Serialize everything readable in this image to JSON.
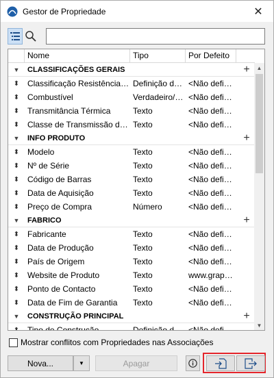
{
  "window": {
    "title": "Gestor de Propriedade"
  },
  "icons": {
    "app": "archicad-logo-icon",
    "close": "close-icon",
    "list_view": "list-view-icon",
    "search": "search-icon",
    "drag_handle": "drag-handle-icon",
    "collapse": "collapse-triangle-icon",
    "add": "plus-icon",
    "info": "info-icon",
    "import": "import-icon",
    "export": "export-icon"
  },
  "search": {
    "value": ""
  },
  "table": {
    "headers": {
      "name": "Nome",
      "type": "Tipo",
      "default": "Por Defeito"
    },
    "groups": [
      {
        "name": "CLASSIFICAÇÕES GERAIS",
        "rows": [
          {
            "name": "Classificação Resistência ao Fogo",
            "type": "Definição de Opções",
            "default": "<Não definido>"
          },
          {
            "name": "Combustível",
            "type": "Verdadeiro/Falso",
            "default": "<Não definido>"
          },
          {
            "name": "Transmitância Térmica",
            "type": "Texto",
            "default": "<Não definido>"
          },
          {
            "name": "Classe de Transmissão de Som",
            "type": "Texto",
            "default": "<Não definido>"
          }
        ]
      },
      {
        "name": "INFO PRODUTO",
        "rows": [
          {
            "name": "Modelo",
            "type": "Texto",
            "default": "<Não definido>"
          },
          {
            "name": "Nº de Série",
            "type": "Texto",
            "default": "<Não definido>"
          },
          {
            "name": "Código de Barras",
            "type": "Texto",
            "default": "<Não definido>"
          },
          {
            "name": "Data de Aquisição",
            "type": "Texto",
            "default": "<Não definido>"
          },
          {
            "name": "Preço de Compra",
            "type": "Número",
            "default": "<Não definido>"
          }
        ]
      },
      {
        "name": "FABRICO",
        "rows": [
          {
            "name": "Fabricante",
            "type": "Texto",
            "default": "<Não definido>"
          },
          {
            "name": "Data de Produção",
            "type": "Texto",
            "default": "<Não definido>"
          },
          {
            "name": "País de Origem",
            "type": "Texto",
            "default": "<Não definido>"
          },
          {
            "name": "Website de Produto",
            "type": "Texto",
            "default": "www.graphisoft.com"
          },
          {
            "name": "Ponto de Contacto",
            "type": "Texto",
            "default": "<Não definido>"
          },
          {
            "name": "Data de Fim de Garantia",
            "type": "Texto",
            "default": "<Não definido>"
          }
        ]
      },
      {
        "name": "CONSTRUÇÃO PRINCIPAL",
        "rows": [
          {
            "name": "Tipo de Construção",
            "type": "Definição de Opções",
            "default": "<Não definido>"
          }
        ]
      }
    ]
  },
  "footer": {
    "conflicts_label": "Mostrar conflitos com Propriedades nas Associações",
    "conflicts_checked": false,
    "new_label": "Nova...",
    "delete_label": "Apagar",
    "delete_enabled": false,
    "highlight_color": "#e4252b"
  }
}
